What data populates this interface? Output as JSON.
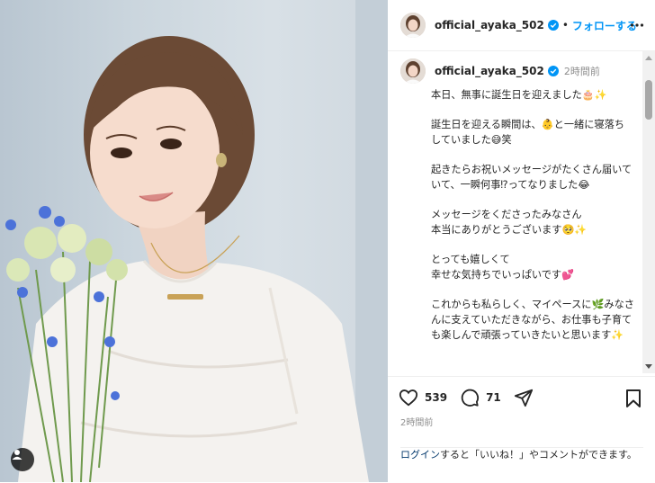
{
  "post": {
    "username": "official_ayaka_502",
    "follow_label": "フォローする",
    "separator": "•",
    "time_ago": "2時間前",
    "likes": "539",
    "comments": "71",
    "timestamp": "2時間前"
  },
  "caption": {
    "p1": "本日、無事に誕生日を迎えました",
    "p1_emoji": "🎂✨",
    "p2_a": "誕生日を迎える瞬間は、",
    "p2_emoji1": "👶",
    "p2_b": "と一緒に寝落ちしていました",
    "p2_emoji2": "😅",
    "p2_c": "笑",
    "p3": "起きたらお祝いメッセージがたくさん届いていて、一瞬何事⁉︎ってなりました",
    "p3_emoji": "😂",
    "p4_a": "メッセージをくださったみなさん",
    "p4_b": "本当にありがとうございます",
    "p4_emoji": "🥺✨",
    "p5_a": "とっても嬉しくて",
    "p5_b": "幸せな気持ちでいっぱいです",
    "p5_emoji": "💕",
    "p6_a": "これからも私らしく、マイペースに",
    "p6_emoji1": "🌿",
    "p6_b": "みなさんに支えていただきながら、お仕事も子育ても楽しんで頑張っていきたいと思います",
    "p6_emoji2": "✨"
  },
  "login": {
    "link": "ログイン",
    "text": "すると「いいね！」やコメントができます。"
  },
  "colors": {
    "accent": "#0095f6",
    "verified": "#0095f6",
    "link": "#00376b",
    "muted": "#8e8e8e"
  },
  "icons": {
    "like": "heart-icon",
    "comment": "comment-bubble-icon",
    "share": "paper-plane-icon",
    "save": "bookmark-icon",
    "verified": "verified-badge-icon",
    "more": "more-options-icon",
    "user_tag": "user-tag-icon"
  }
}
